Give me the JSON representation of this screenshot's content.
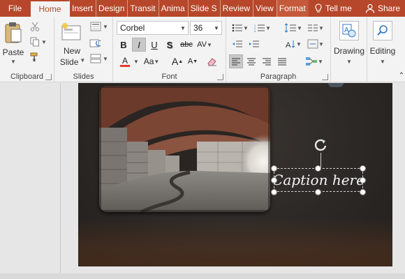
{
  "tabs": {
    "file": "File",
    "home": "Home",
    "insert": "Insert",
    "design": "Design",
    "transitions": "Transit",
    "animations": "Anima",
    "slideshow": "Slide S",
    "review": "Review",
    "view": "View",
    "format": "Format",
    "tellme": "Tell me",
    "share": "Share"
  },
  "clipboard": {
    "paste_label": "Paste",
    "group_label": "Clipboard"
  },
  "slides": {
    "new_slide_label": "New",
    "new_slide_label2": "Slide",
    "group_label": "Slides"
  },
  "font": {
    "font_name": "Corbel",
    "font_size": "36",
    "bold": "B",
    "italic": "I",
    "underline": "U",
    "shadow": "S",
    "strike": "abc",
    "spacing": "AV",
    "font_color": "A",
    "change_case": "Aa",
    "grow": "A",
    "shrink": "A",
    "group_label": "Font"
  },
  "paragraph": {
    "group_label": "Paragraph"
  },
  "drawing": {
    "label": "Drawing"
  },
  "editing": {
    "label": "Editing"
  },
  "slide": {
    "caption_text": "Caption here"
  },
  "colors": {
    "accent": "#b7472a",
    "ribbon": "#f3f3f3"
  }
}
